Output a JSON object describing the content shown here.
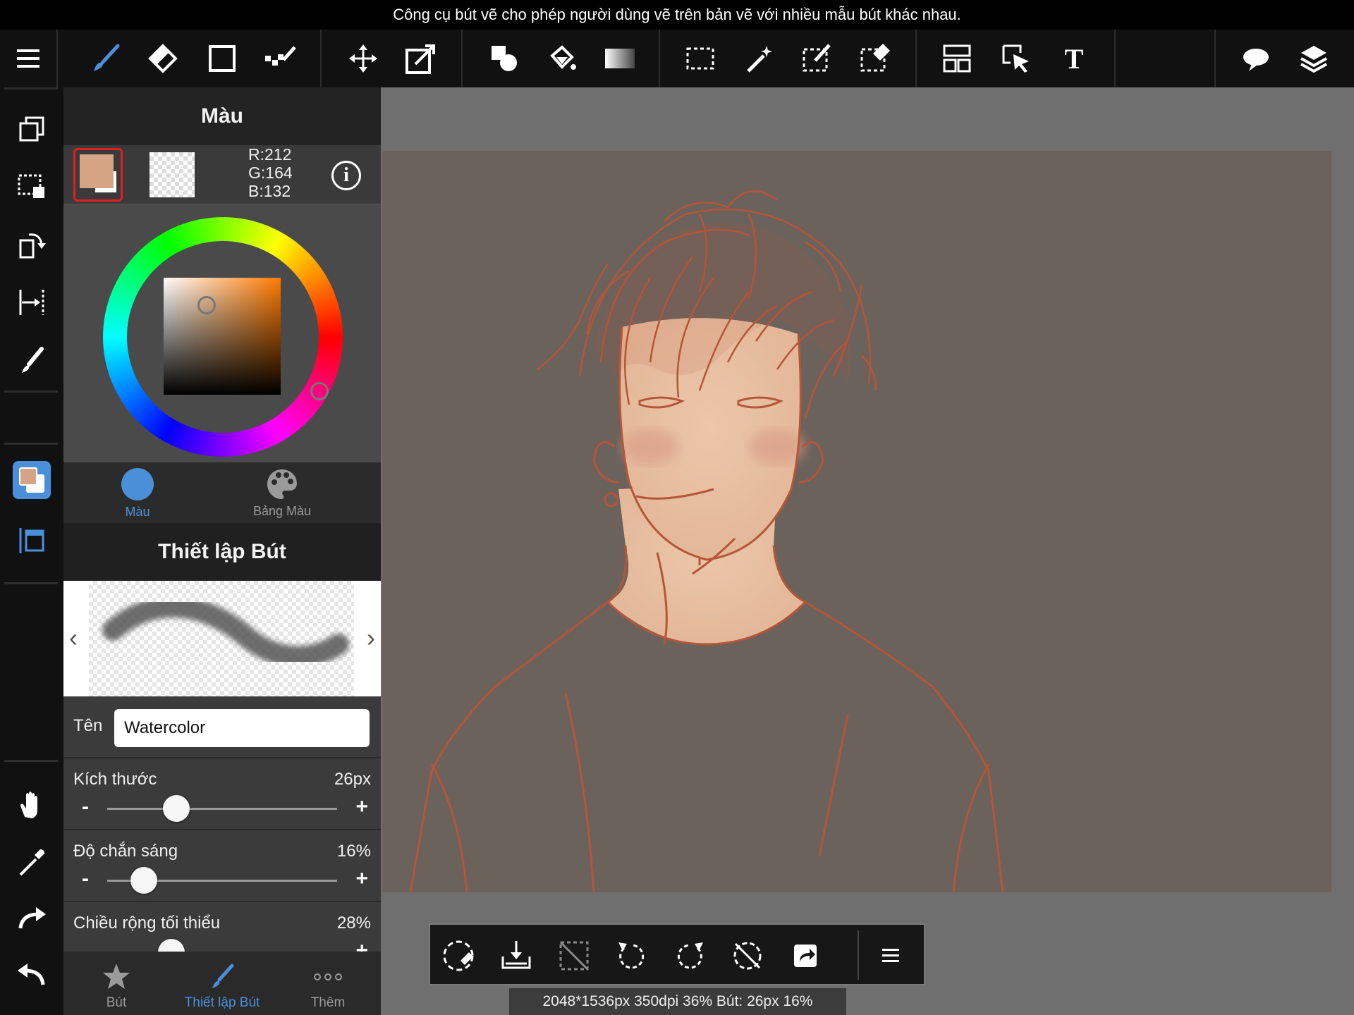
{
  "caption": "Công cụ bút vẽ cho phép người dùng vẽ trên bản vẽ với nhiều mẫu bút khác nhau.",
  "toolbar": {
    "icons": [
      "menu-icon",
      "brush-tool-icon",
      "eraser-tool-icon",
      "shape-tool-icon",
      "dot-tool-icon",
      "move-tool-icon",
      "transform-tool-icon",
      "fill-shape-icon",
      "bucket-icon",
      "gradient-icon",
      "select-rect-icon",
      "magic-wand-icon",
      "select-pen-icon",
      "select-eraser-icon",
      "frame-divider-icon",
      "select-layer-icon",
      "text-tool-icon",
      "speech-bubble-icon",
      "layers-icon"
    ]
  },
  "color_panel": {
    "title": "Màu",
    "rgb": {
      "r": "R:212",
      "g": "G:164",
      "b": "B:132"
    },
    "primary_color": "#d4a484",
    "tabs": [
      {
        "label": "Màu"
      },
      {
        "label": "Bảng Màu"
      }
    ]
  },
  "brush_panel": {
    "title": "Thiết lập Bút",
    "name_label": "Tên",
    "name_value": "Watercolor",
    "sliders": [
      {
        "label": "Kích thước",
        "value": "26px",
        "fraction": 0.3
      },
      {
        "label": "Độ chắn sáng",
        "value": "16%",
        "fraction": 0.16
      },
      {
        "label": "Chiều rộng tối thiểu",
        "value": "28%",
        "fraction": 0.28
      }
    ],
    "minus": "-",
    "plus": "+"
  },
  "bottom_tabs": [
    {
      "label": "Bút",
      "icon": "star-icon"
    },
    {
      "label": "Thiết lập Bút",
      "icon": "brush-icon"
    },
    {
      "label": "Thêm",
      "icon": "more-icon"
    }
  ],
  "status": "2048*1536px 350dpi 36% Bút: 26px 16%",
  "colors": {
    "accent": "#4a90d9",
    "highlight_red": "#e02020",
    "line_art": "#b5553a"
  }
}
